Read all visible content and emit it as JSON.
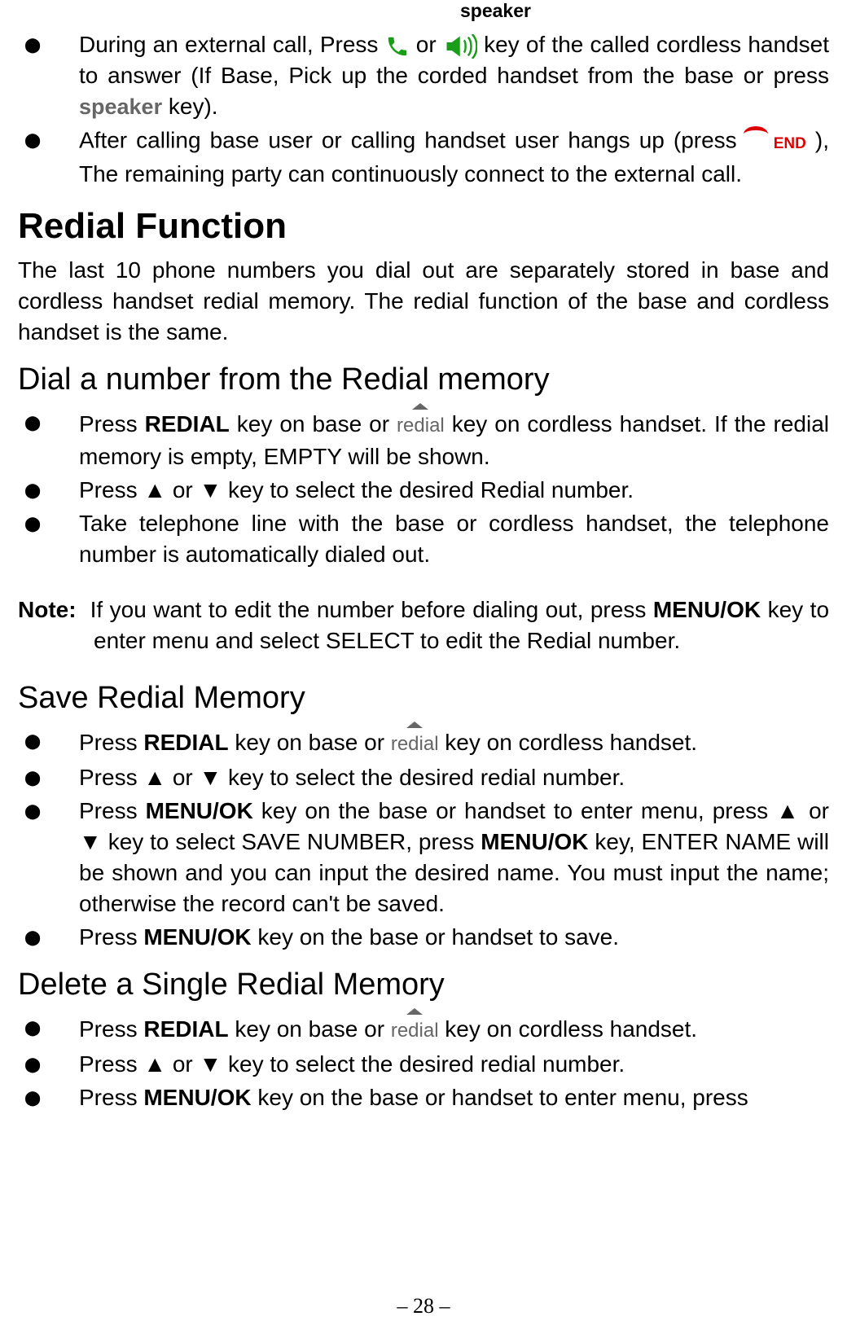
{
  "top_label": "speaker",
  "intro_list": [
    {
      "pre": "During an external call, Press ",
      "mid1": " or ",
      "post1": " key of the called cordless handset to answer (If Base, Pick up the corded handset from the base or press ",
      "post2": " key)."
    },
    {
      "pre": "After calling base user or calling handset user hangs up (press ",
      "post": "), The remaining party can continuously connect to the external call."
    }
  ],
  "h1": "Redial Function",
  "intro_para": "The last 10 phone numbers you dial out are separately stored in base and cordless handset redial memory. The redial function of the base and cordless handset is the same.",
  "sections": {
    "dial": {
      "title": "Dial a number from the Redial memory",
      "items": [
        {
          "pre": "Press ",
          "b1": "REDIAL",
          "mid": " key on base or ",
          "post": " key on cordless handset. If the redial memory is empty, EMPTY will be shown."
        },
        {
          "text": "Press ▲ or ▼ key to select the desired Redial number."
        },
        {
          "text": "Take telephone line with the base or cordless handset, the telephone number is automatically dialed out."
        }
      ]
    },
    "note": {
      "label": "Note:",
      "body_pre": "If you want to edit the number before dialing out, press ",
      "body_b": "MENU/OK",
      "body_post": " key to enter menu and select SELECT to edit the Redial number."
    },
    "save": {
      "title": "Save Redial Memory",
      "items": [
        {
          "pre": "Press ",
          "b1": "REDIAL",
          "mid": " key on base or ",
          "post": " key on cordless handset."
        },
        {
          "text": "Press ▲ or ▼ key to select the desired redial number."
        },
        {
          "pre": "Press ",
          "b1": "MENU/OK",
          "mid": " key on the base or handset to enter menu, press ▲ or ▼ key to select SAVE NUMBER, press ",
          "b2": "MENU/OK",
          "post": " key, ENTER NAME will be shown and you can input the desired name. You must input the name; otherwise the record can't be saved."
        },
        {
          "pre": "Press ",
          "b1": "MENU/OK",
          "post": " key on the base or handset to save."
        }
      ]
    },
    "delete": {
      "title": "Delete a Single Redial Memory",
      "items": [
        {
          "pre": "Press ",
          "b1": "REDIAL",
          "mid": " key on base or ",
          "post": " key on cordless handset."
        },
        {
          "text": "Press ▲ or ▼ key to select the desired redial number."
        },
        {
          "pre": "Press ",
          "b1": "MENU/OK",
          "post": " key on the base or handset to enter menu, press"
        }
      ]
    }
  },
  "keys": {
    "speaker": "speaker",
    "redial": "redial",
    "end": "END"
  },
  "page_number": "– 28 –"
}
